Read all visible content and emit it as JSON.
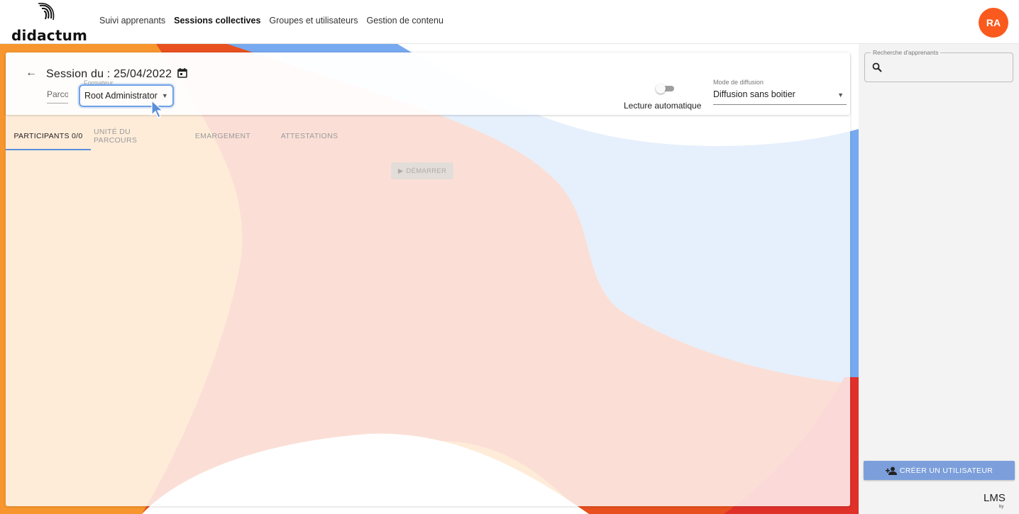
{
  "topbar": {
    "logo_text": "didactum",
    "nav": [
      {
        "label": "Suivi apprenants",
        "active": false
      },
      {
        "label": "Sessions collectives",
        "active": true
      },
      {
        "label": "Groupes et utilisateurs",
        "active": false
      },
      {
        "label": "Gestion de contenu",
        "active": false
      }
    ],
    "avatar_initials": "RA",
    "avatar_color": "#fa5a1e"
  },
  "session": {
    "title": "Session du : 25/04/2022",
    "back_icon": "arrow-left-icon",
    "calendar_icon": "calendar-icon",
    "parcours_label": "Parcours",
    "formateur_label": "Formateur",
    "formateur_value": "Root Administrator",
    "auto_play_label": "Lecture automatique",
    "auto_play_on": false,
    "mode_label": "Mode de diffusion",
    "mode_value": "Diffusion sans boitier"
  },
  "tabs": [
    {
      "label": "PARTICIPANTS 0/0",
      "active": true
    },
    {
      "label": "UNITÉ DU PARCOURS",
      "active": false
    },
    {
      "label": "EMARGEMENT",
      "active": false
    },
    {
      "label": "ATTESTATIONS",
      "active": false
    }
  ],
  "start_button": {
    "label": "DÉMARRER",
    "icon": "play-icon",
    "disabled": true
  },
  "sidepanel": {
    "search_legend": "Recherche d'apprenants",
    "search_icon": "search-icon",
    "create_button": "CRÉER UN UTILISATEUR",
    "create_icon": "add-person-icon",
    "brand_mark": "LMS",
    "brand_by": "by"
  },
  "colors": {
    "accent_blue": "#5b8fd9",
    "button_blue": "#7c9fdb",
    "orange": "#f7962e",
    "red_orange": "#e8501f",
    "red": "#e0302a",
    "light_blue": "#76a9ef"
  }
}
